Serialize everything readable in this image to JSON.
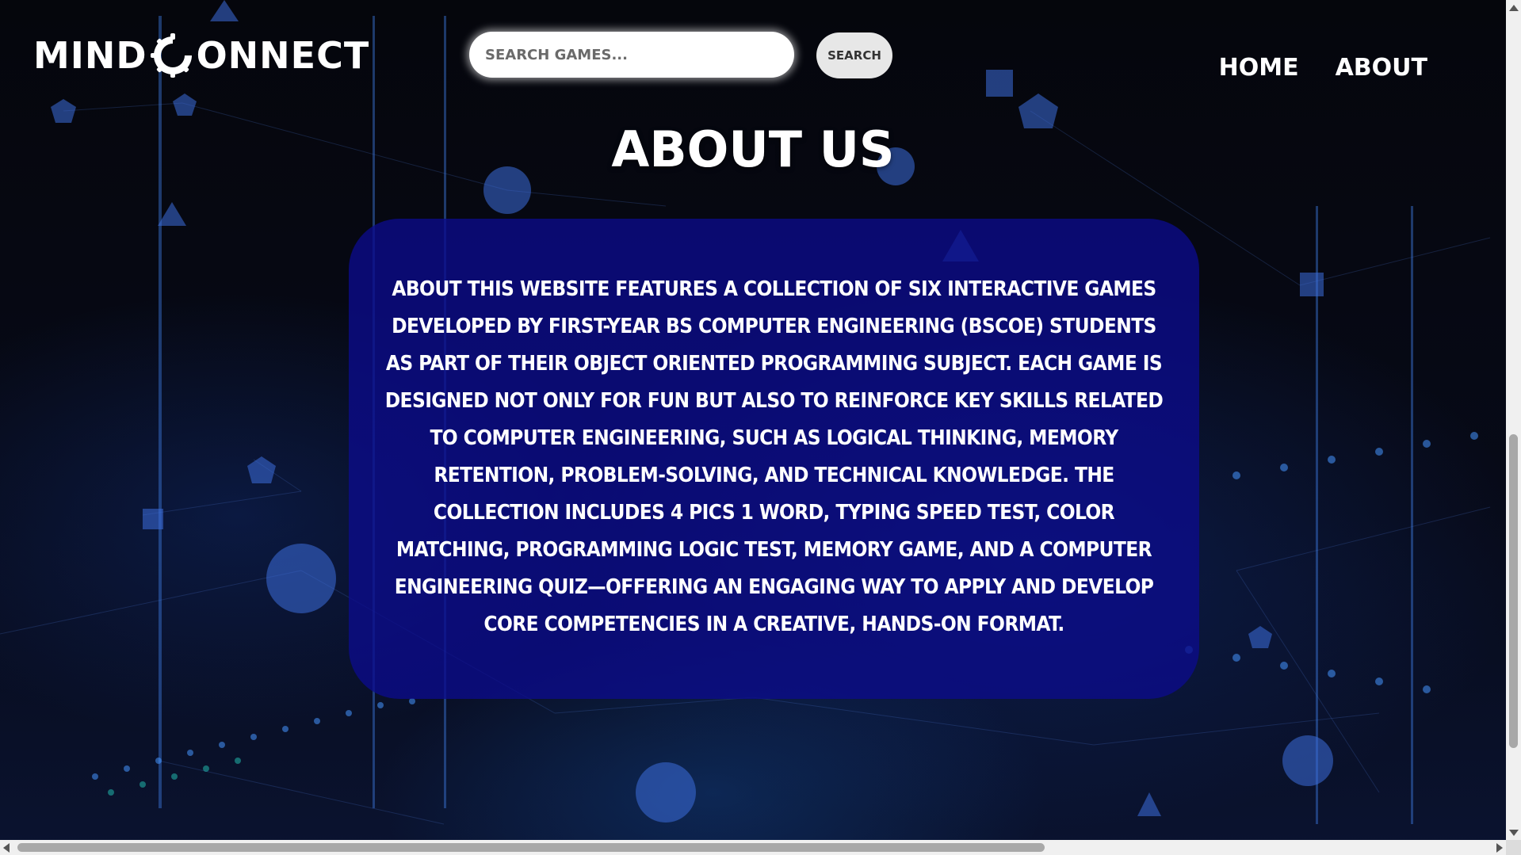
{
  "header": {
    "logo_text_left": "MIND",
    "logo_text_right": "ONNECT",
    "logo_icon": "gear-c-icon"
  },
  "search": {
    "placeholder": "Search games...",
    "button_label": "Search"
  },
  "nav": {
    "items": [
      {
        "label": "Home"
      },
      {
        "label": "About"
      }
    ]
  },
  "main": {
    "title": "About Us",
    "about_text": "About This website features a collection of six interactive games developed by first-year BS Computer Engineering (BSCoE) students as part of their Object Oriented Programming subject. Each game is designed not only for fun but also to reinforce key skills related to computer engineering, such as logical thinking, memory retention, problem-solving, and technical knowledge. The collection includes 4 Pics 1 Word, Typing Speed Test, Color Matching, Programming Logic Test, Memory Game, and a Computer Engineering Quiz—offering an engaging way to apply and develop core competencies in a creative, hands-on format."
  },
  "colors": {
    "card_background": "#0c0c8c",
    "text": "#ffffff",
    "page_background": "#06070f",
    "network_accent": "#1e5bd6"
  }
}
